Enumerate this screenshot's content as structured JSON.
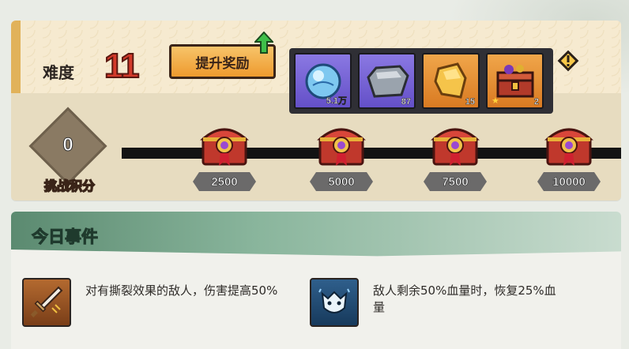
{
  "difficulty": {
    "label": "难度",
    "value": "11"
  },
  "upgrade_button": {
    "label": "提升奖励"
  },
  "rewards": [
    {
      "icon": "crystal-orb-icon",
      "count": "5.1万",
      "rarity": "purple",
      "star": false
    },
    {
      "icon": "anvil-ore-icon",
      "count": "87",
      "rarity": "purple",
      "star": false
    },
    {
      "icon": "gold-ingot-icon",
      "count": "15",
      "rarity": "orange",
      "star": false
    },
    {
      "icon": "treasure-box-icon",
      "count": "2",
      "rarity": "orange",
      "star": true
    }
  ],
  "score": {
    "value": "0",
    "label": "挑战积分"
  },
  "milestones": [
    {
      "value": "2500"
    },
    {
      "value": "5000"
    },
    {
      "value": "7500"
    },
    {
      "value": "10000"
    }
  ],
  "events": {
    "title": "今日事件",
    "items": [
      {
        "icon": "sword-icon",
        "text": "对有撕裂效果的敌人，伤害提高50%"
      },
      {
        "icon": "beast-head-icon",
        "text": "敌人剩余50%血量时，恢复25%血量"
      }
    ]
  },
  "colors": {
    "difficulty_red": "#d23a2a",
    "button_orange": "#ee9a2e",
    "rarity_purple": "#6450c8",
    "rarity_orange": "#d97a22",
    "header_green": "#5b8a70"
  }
}
